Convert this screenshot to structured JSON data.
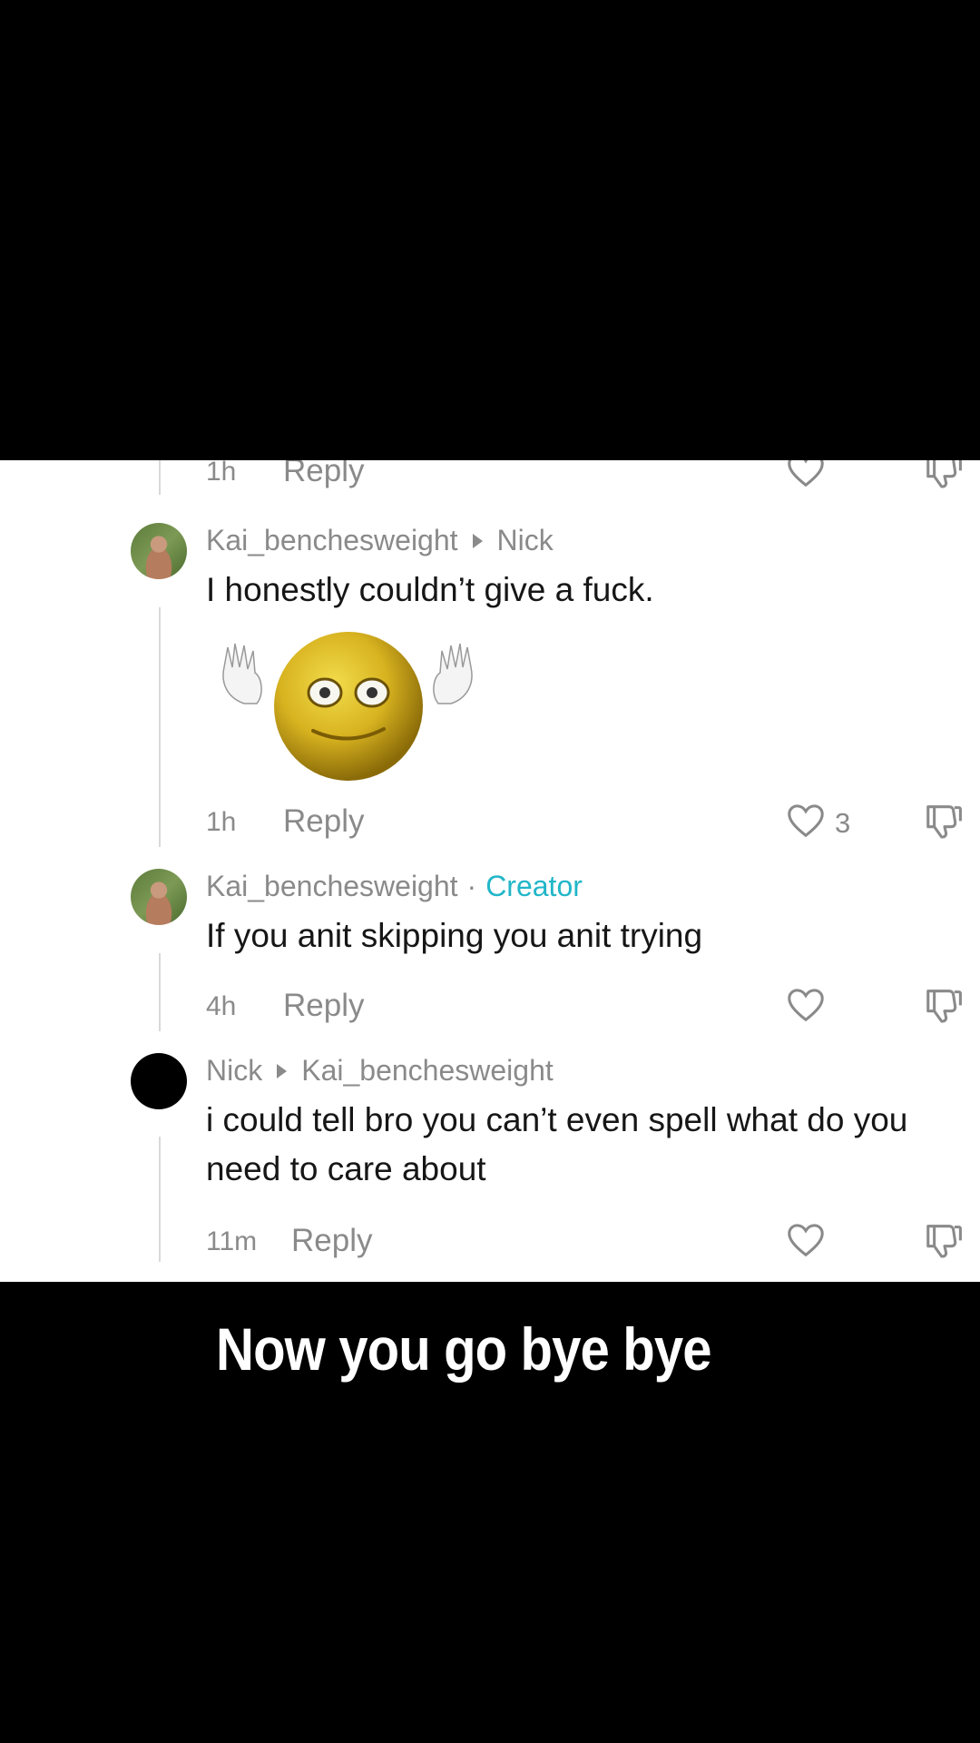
{
  "comments": [
    {
      "time": "1h",
      "reply_label": "Reply"
    },
    {
      "author": "Kai_benchesweight",
      "reply_to": "Nick",
      "text": "I honestly couldn’t give a fuck.",
      "sticker": "waving-smiley-emoji",
      "time": "1h",
      "reply_label": "Reply",
      "likes": "3"
    },
    {
      "author": "Kai_benchesweight",
      "badge_separator": "·",
      "badge": "Creator",
      "text": "If you anit skipping you anit trying",
      "time": "4h",
      "reply_label": "Reply"
    },
    {
      "author": "Nick",
      "reply_to": "Kai_benchesweight",
      "text": "i could tell bro you can’t even spell what do you need to care about",
      "time": "11m",
      "reply_label": "Reply"
    }
  ],
  "caption": "Now you go bye bye",
  "icons": {
    "like": "heart-outline-icon",
    "dislike": "thumbs-down-icon"
  },
  "colors": {
    "creator": "#21b6c8",
    "meta": "#8a8a8a"
  }
}
